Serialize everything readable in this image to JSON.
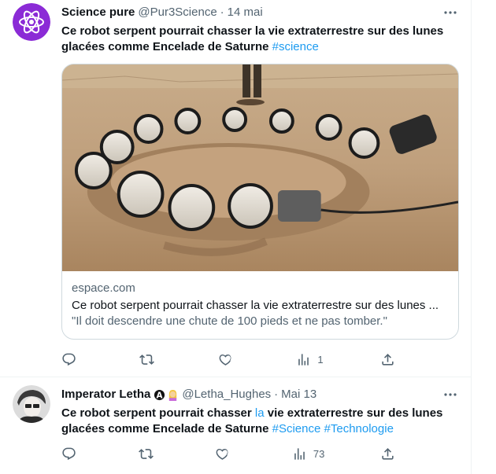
{
  "tweets": [
    {
      "author": {
        "name": "Science pure",
        "handle": "@Pur3Science",
        "avatar_icon": "atom-icon",
        "avatar_color": "#8b2bd6"
      },
      "date": "14 mai",
      "dot": "·",
      "text": "Ce robot serpent pourrait chasser la vie extraterrestre sur des lunes glacées comme Encelade de Saturne ",
      "hashtags": [
        "#science"
      ],
      "card": {
        "domain": "espace.com",
        "title": "Ce robot serpent pourrait chasser la vie extraterrestre sur des lunes ...",
        "description": "\"Il doit descendre une chute de 100 pieds et ne pas tomber.\""
      },
      "actions": {
        "reply": "",
        "retweet": "",
        "like": "",
        "views": "1"
      }
    },
    {
      "author": {
        "name": "Imperator Letha",
        "handle": "@Letha_Hughes",
        "avatar_icon": "person-avatar",
        "badges": [
          "anarchy-symbol-icon",
          "woman-tipping-hand-emoji"
        ]
      },
      "date": "Mai 13",
      "dot": "·",
      "text_before": "Ce robot serpent pourrait chasser ",
      "text_link": "la",
      "text_after": " vie extraterrestre sur des lunes glacées comme Encelade de Saturne ",
      "hashtags": [
        "#Science",
        "#Technologie"
      ],
      "actions": {
        "reply": "",
        "retweet": "",
        "like": "",
        "views": "73"
      }
    }
  ],
  "colors": {
    "accent": "#1d9bf0",
    "muted": "#536471",
    "text": "#0f1419",
    "border": "#cfd9de"
  }
}
